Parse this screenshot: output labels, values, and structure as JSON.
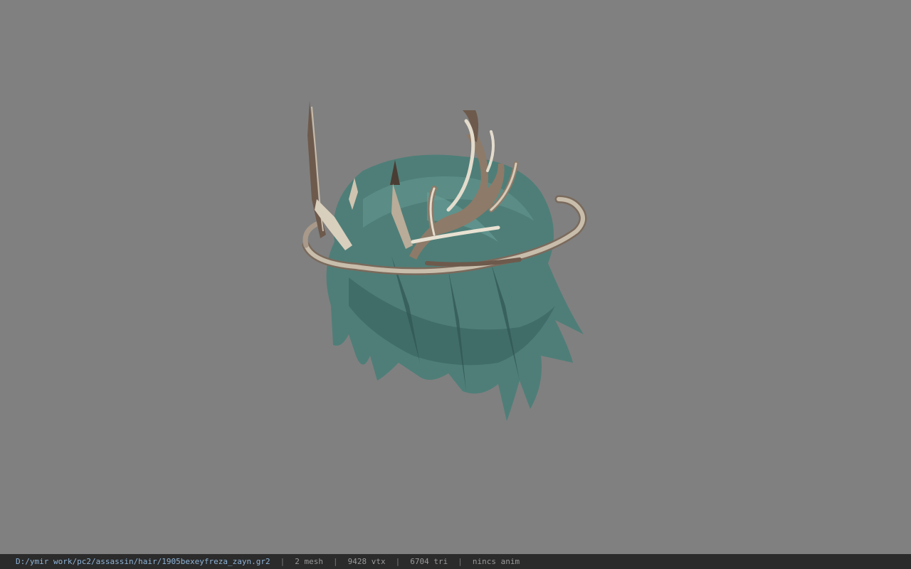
{
  "viewer": {
    "background_color": "#808080",
    "model_icon": "antler-crown-hair-model"
  },
  "status_bar": {
    "path": "D:/ymir work/pc2/assassin/hair/1905bexeyfreza_zayn.gr2",
    "separator": "|",
    "mesh": "2 mesh",
    "vertices": "9428 vtx",
    "triangles": "6704 tri",
    "anim": "nincs anim"
  }
}
